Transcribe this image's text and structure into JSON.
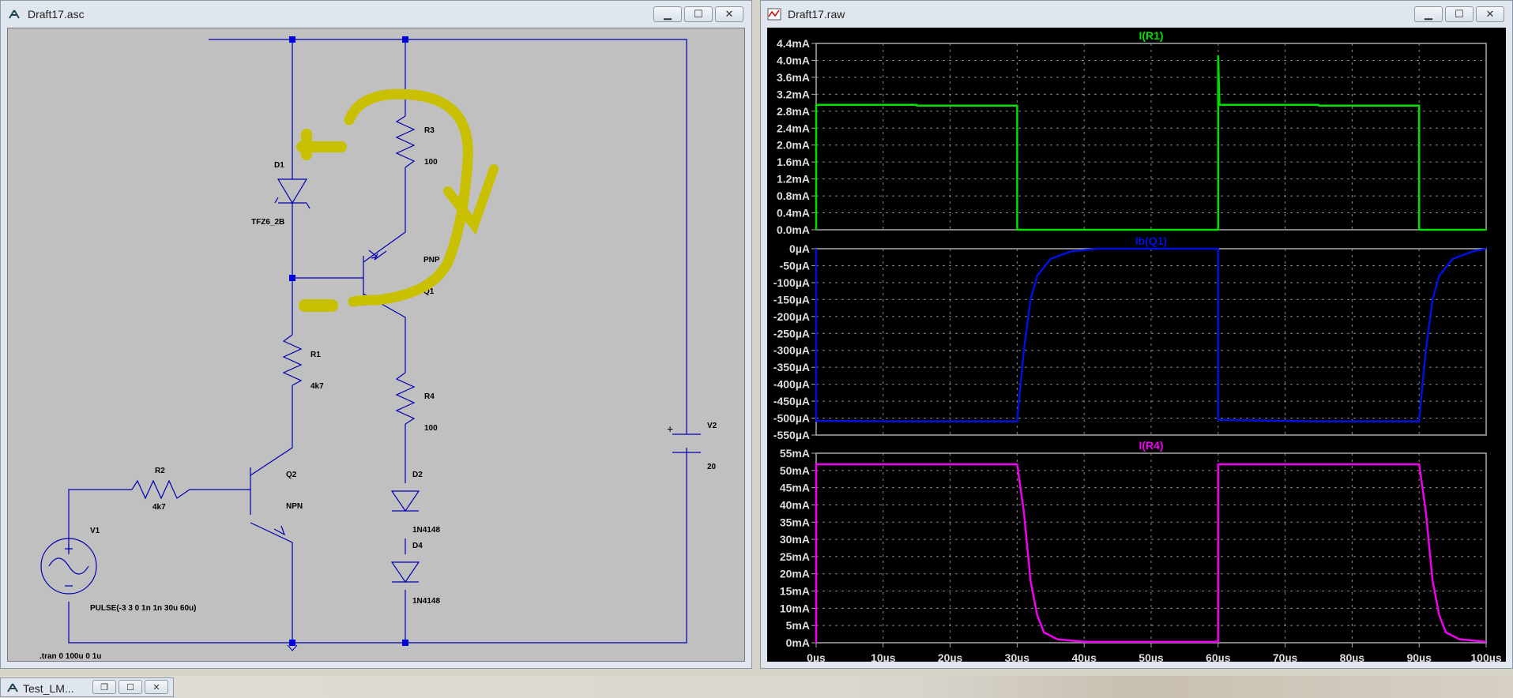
{
  "schematic_window": {
    "title": "Draft17.asc",
    "labels": {
      "d1": "D1",
      "d1_model": "TFZ6_2B",
      "r3": "R3",
      "r3_value": "100",
      "q1_type": "PNP",
      "q1": "Q1",
      "r1": "R1",
      "r1_value": "4k7",
      "r4": "R4",
      "r4_value": "100",
      "d2": "D2",
      "d2_model": "1N4148",
      "d4": "D4",
      "d4_model": "1N4148",
      "r2": "R2",
      "r2_value": "4k7",
      "q2": "Q2",
      "q2_type": "NPN",
      "v1": "V1",
      "v1_value": "PULSE(-3 3 0 1n 1n 30u 60u)",
      "v2": "V2",
      "v2_value": "20",
      "v2_plus": "+",
      "tran": ".tran 0 100u 0 1u"
    },
    "annotation_color": "#c8c000"
  },
  "plot_window": {
    "title": "Draft17.raw",
    "x_ticks": [
      "0µs",
      "10µs",
      "20µs",
      "30µs",
      "40µs",
      "50µs",
      "60µs",
      "70µs",
      "80µs",
      "90µs",
      "100µs"
    ],
    "panes": [
      {
        "title": "I(R1)",
        "color": "#00e000",
        "y_ticks": [
          "4.4mA",
          "4.0mA",
          "3.6mA",
          "3.2mA",
          "2.8mA",
          "2.4mA",
          "2.0mA",
          "1.6mA",
          "1.2mA",
          "0.8mA",
          "0.4mA",
          "0.0mA"
        ]
      },
      {
        "title": "Ib(Q1)",
        "color": "#0010e0",
        "y_ticks": [
          "0µA",
          "-50µA",
          "-100µA",
          "-150µA",
          "-200µA",
          "-250µA",
          "-300µA",
          "-350µA",
          "-400µA",
          "-450µA",
          "-500µA",
          "-550µA"
        ]
      },
      {
        "title": "I(R4)",
        "color": "#f000f0",
        "y_ticks": [
          "55mA",
          "50mA",
          "45mA",
          "40mA",
          "35mA",
          "30mA",
          "25mA",
          "20mA",
          "15mA",
          "10mA",
          "5mA",
          "0mA"
        ]
      }
    ]
  },
  "chart_data": [
    {
      "type": "line",
      "title": "I(R1)",
      "xlabel": "",
      "ylabel": "",
      "xlim": [
        0,
        100
      ],
      "ylim": [
        0,
        4.4
      ],
      "series": [
        {
          "x": [
            0,
            0,
            15,
            15,
            30,
            30,
            60,
            60,
            60.2,
            75,
            75,
            90,
            90,
            100
          ],
          "y": [
            0,
            2.95,
            2.95,
            2.93,
            2.93,
            0,
            0,
            4.1,
            2.95,
            2.95,
            2.93,
            2.93,
            0,
            0
          ]
        }
      ]
    },
    {
      "type": "line",
      "title": "Ib(Q1)",
      "xlabel": "",
      "ylabel": "",
      "xlim": [
        0,
        100
      ],
      "ylim": [
        -550,
        0
      ],
      "series": [
        {
          "x": [
            0,
            0,
            15,
            30,
            30,
            31,
            32,
            33,
            35,
            38,
            42,
            60,
            60,
            75,
            90,
            90,
            91,
            92,
            93,
            95,
            98,
            100
          ],
          "y": [
            0,
            -508,
            -510,
            -510,
            -505,
            -300,
            -150,
            -80,
            -30,
            -8,
            0,
            0,
            -505,
            -510,
            -510,
            -505,
            -300,
            -150,
            -80,
            -30,
            -8,
            0
          ]
        }
      ]
    },
    {
      "type": "line",
      "title": "I(R4)",
      "xlabel": "",
      "ylabel": "",
      "xlim": [
        0,
        100
      ],
      "ylim": [
        0,
        55
      ],
      "series": [
        {
          "x": [
            0,
            0,
            30,
            31,
            32,
            33,
            34,
            36,
            40,
            60,
            60,
            90,
            91,
            92,
            93,
            94,
            96,
            100
          ],
          "y": [
            0,
            51.8,
            51.8,
            38,
            18,
            8,
            3,
            1,
            0.3,
            0.3,
            51.8,
            51.8,
            38,
            18,
            8,
            3,
            1,
            0.3
          ]
        }
      ]
    }
  ],
  "taskbar": {
    "item_title": "Test_LM..."
  }
}
